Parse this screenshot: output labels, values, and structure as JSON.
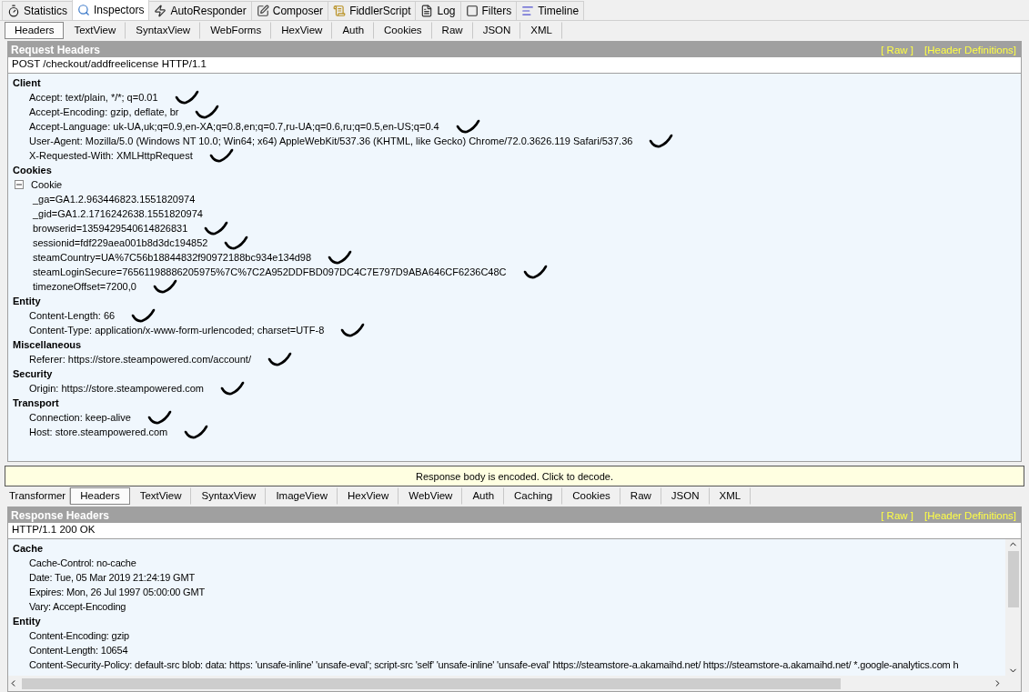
{
  "main_tabs": [
    {
      "label": "Statistics",
      "selected": false
    },
    {
      "label": "Inspectors",
      "selected": true
    },
    {
      "label": "AutoResponder",
      "selected": false
    },
    {
      "label": "Composer",
      "selected": false
    },
    {
      "label": "FiddlerScript",
      "selected": false
    },
    {
      "label": "Log",
      "selected": false
    },
    {
      "label": "Filters",
      "selected": false
    },
    {
      "label": "Timeline",
      "selected": false
    }
  ],
  "request": {
    "tabs": [
      {
        "label": "Headers",
        "selected": true
      },
      {
        "label": "TextView",
        "selected": false
      },
      {
        "label": "SyntaxView",
        "selected": false
      },
      {
        "label": "WebForms",
        "selected": false
      },
      {
        "label": "HexView",
        "selected": false
      },
      {
        "label": "Auth",
        "selected": false
      },
      {
        "label": "Cookies",
        "selected": false
      },
      {
        "label": "Raw",
        "selected": false
      },
      {
        "label": "JSON",
        "selected": false
      },
      {
        "label": "XML",
        "selected": false
      }
    ],
    "panel": {
      "title": "Request Headers",
      "links": [
        "[ Raw ]",
        "[Header Definitions]"
      ],
      "first_line": "POST /checkout/addfreelicense HTTP/1.1",
      "groups": [
        {
          "name": "Client",
          "items": [
            {
              "text": "Accept: text/plain, */*; q=0.01",
              "ticked": true
            },
            {
              "text": "Accept-Encoding: gzip, deflate, br",
              "ticked": true
            },
            {
              "text": "Accept-Language: uk-UA,uk;q=0.9,en-XA;q=0.8,en;q=0.7,ru-UA;q=0.6,ru;q=0.5,en-US;q=0.4",
              "ticked": true
            },
            {
              "text": "User-Agent: Mozilla/5.0 (Windows NT 10.0; Win64; x64) AppleWebKit/537.36 (KHTML, like Gecko) Chrome/72.0.3626.119 Safari/537.36",
              "ticked": true
            },
            {
              "text": "X-Requested-With: XMLHttpRequest",
              "ticked": true
            }
          ]
        },
        {
          "name": "Cookies",
          "items": [
            {
              "text": "Cookie",
              "ticked": false,
              "expanded": true,
              "children": [
                {
                  "text": "_ga=GA1.2.963446823.1551820974",
                  "ticked": false
                },
                {
                  "text": "_gid=GA1.2.1716242638.1551820974",
                  "ticked": false
                },
                {
                  "text": "browserid=1359429540614826831",
                  "ticked": true
                },
                {
                  "text": "sessionid=fdf229aea001b8d3dc194852",
                  "ticked": true
                },
                {
                  "text": "steamCountry=UA%7C56b18844832f90972188bc934e134d98",
                  "ticked": true
                },
                {
                  "text": "steamLoginSecure=76561198886205975%7C%7C2A952DDFBD097DC4C7E797D9ABA646CF6236C48C",
                  "ticked": true
                },
                {
                  "text": "timezoneOffset=7200,0",
                  "ticked": true
                }
              ]
            }
          ]
        },
        {
          "name": "Entity",
          "items": [
            {
              "text": "Content-Length: 66",
              "ticked": true
            },
            {
              "text": "Content-Type: application/x-www-form-urlencoded; charset=UTF-8",
              "ticked": true
            }
          ]
        },
        {
          "name": "Miscellaneous",
          "items": [
            {
              "text": "Referer: https://store.steampowered.com/account/",
              "ticked": true
            }
          ]
        },
        {
          "name": "Security",
          "items": [
            {
              "text": "Origin: https://store.steampowered.com",
              "ticked": true
            }
          ]
        },
        {
          "name": "Transport",
          "items": [
            {
              "text": "Connection: keep-alive",
              "ticked": true
            },
            {
              "text": "Host: store.steampowered.com",
              "ticked": true
            }
          ]
        }
      ]
    }
  },
  "notice": "Response body is encoded. Click to decode.",
  "response": {
    "tabs": [
      {
        "label": "Transformer",
        "selected": false
      },
      {
        "label": "Headers",
        "selected": true
      },
      {
        "label": "TextView",
        "selected": false
      },
      {
        "label": "SyntaxView",
        "selected": false
      },
      {
        "label": "ImageView",
        "selected": false
      },
      {
        "label": "HexView",
        "selected": false
      },
      {
        "label": "WebView",
        "selected": false
      },
      {
        "label": "Auth",
        "selected": false
      },
      {
        "label": "Caching",
        "selected": false
      },
      {
        "label": "Cookies",
        "selected": false
      },
      {
        "label": "Raw",
        "selected": false
      },
      {
        "label": "JSON",
        "selected": false
      },
      {
        "label": "XML",
        "selected": false
      }
    ],
    "panel": {
      "title": "Response Headers",
      "links": [
        "[ Raw ]",
        "[Header Definitions]"
      ],
      "first_line": "HTTP/1.1 200 OK",
      "groups": [
        {
          "name": "Cache",
          "items": [
            {
              "text": "Cache-Control: no-cache"
            },
            {
              "text": "Date: Tue, 05 Mar 2019 21:24:19 GMT"
            },
            {
              "text": "Expires: Mon, 26 Jul 1997 05:00:00 GMT"
            },
            {
              "text": "Vary: Accept-Encoding"
            }
          ]
        },
        {
          "name": "Entity",
          "items": [
            {
              "text": "Content-Encoding: gzip"
            },
            {
              "text": "Content-Length: 10654"
            },
            {
              "text": "Content-Security-Policy: default-src blob: data: https: 'unsafe-inline' 'unsafe-eval'; script-src 'self' 'unsafe-inline' 'unsafe-eval' https://steamstore-a.akamaihd.net/ https://steamstore-a.akamaihd.net/ *.google-analytics.com h"
            }
          ]
        }
      ]
    }
  }
}
